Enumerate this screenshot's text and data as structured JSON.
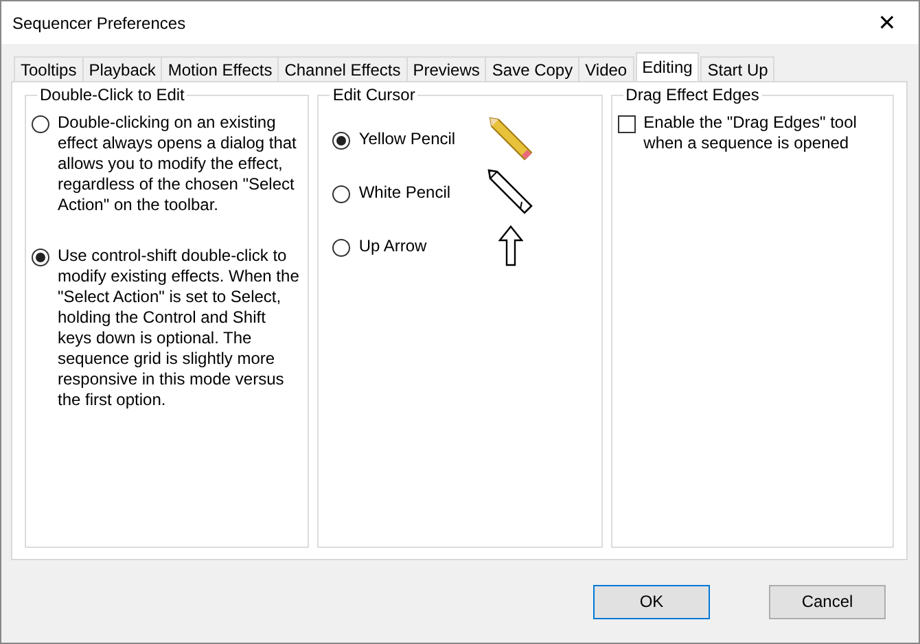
{
  "window": {
    "title": "Sequencer Preferences",
    "close": "✕"
  },
  "tabs": [
    {
      "label": "Tooltips",
      "selected": false
    },
    {
      "label": "Playback",
      "selected": false
    },
    {
      "label": "Motion Effects",
      "selected": false
    },
    {
      "label": "Channel Effects",
      "selected": false
    },
    {
      "label": "Previews",
      "selected": false
    },
    {
      "label": "Save Copy",
      "selected": false
    },
    {
      "label": "Video",
      "selected": false
    },
    {
      "label": "Editing",
      "selected": true
    },
    {
      "label": "Start Up",
      "selected": false
    }
  ],
  "double_click": {
    "title": "Double-Click to Edit",
    "options": [
      {
        "label": "Double-clicking on an existing effect always opens a dialog that allows you to modify the effect, regardless of the chosen \"Select Action\" on the toolbar.",
        "selected": false
      },
      {
        "label": "Use control-shift double-click to modify existing effects. When the \"Select Action\" is set to Select, holding the Control and Shift keys down is optional. The sequence grid is slightly more responsive in this mode versus the first option.",
        "selected": true
      }
    ]
  },
  "edit_cursor": {
    "title": "Edit Cursor",
    "options": [
      {
        "label": "Yellow Pencil",
        "selected": true,
        "kind": "yellow-pencil"
      },
      {
        "label": "White Pencil",
        "selected": false,
        "kind": "white-pencil"
      },
      {
        "label": "Up Arrow",
        "selected": false,
        "kind": "up-arrow"
      }
    ]
  },
  "drag_edges": {
    "title": "Drag Effect Edges",
    "checkbox": {
      "label": "Enable the \"Drag Edges\" tool when a sequence is opened",
      "checked": false
    }
  },
  "buttons": [
    "OK",
    "Cancel"
  ]
}
